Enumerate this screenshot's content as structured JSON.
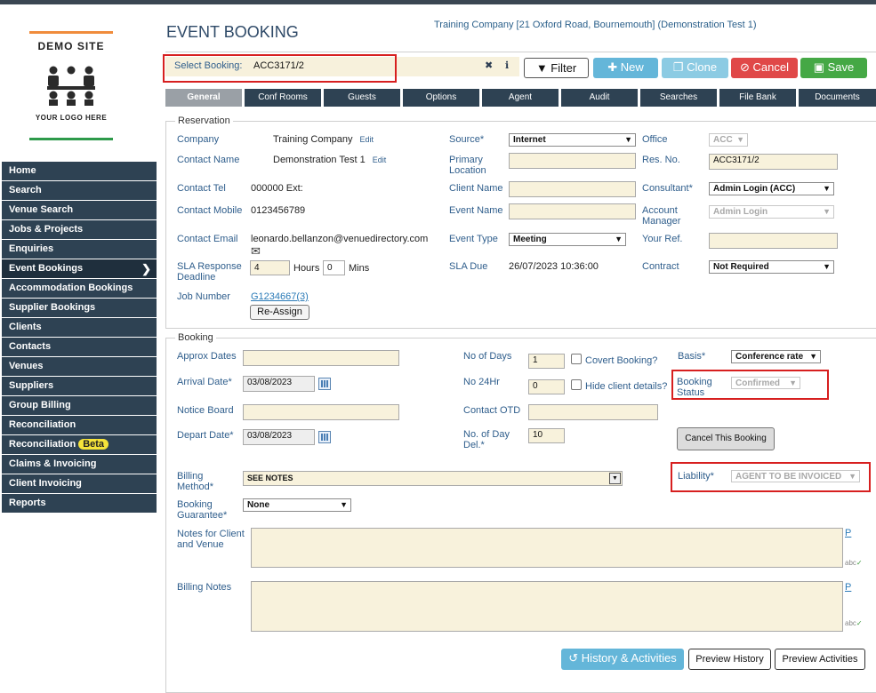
{
  "logo": {
    "line1": "DEMO SITE",
    "line2": "YOUR LOGO HERE",
    "accent_top": "#f08c3c",
    "accent_bottom": "#2e9a4a"
  },
  "nav": {
    "items": [
      {
        "label": "Home"
      },
      {
        "label": "Search"
      },
      {
        "label": "Venue Search"
      },
      {
        "label": "Jobs & Projects"
      },
      {
        "label": "Enquiries"
      },
      {
        "label": "Event Bookings",
        "active": true
      },
      {
        "label": "Accommodation Bookings"
      },
      {
        "label": "Supplier Bookings"
      },
      {
        "label": "Clients"
      },
      {
        "label": "Contacts"
      },
      {
        "label": "Venues"
      },
      {
        "label": "Suppliers"
      },
      {
        "label": "Group Billing"
      },
      {
        "label": "Reconciliation"
      },
      {
        "label": "Reconciliation",
        "badge": "Beta"
      },
      {
        "label": "Claims & Invoicing"
      },
      {
        "label": "Client Invoicing"
      },
      {
        "label": "Reports"
      }
    ]
  },
  "header": {
    "title": "EVENT BOOKING",
    "company": "Training Company [21 Oxford Road, Bournemouth] (Demonstration Test 1)"
  },
  "select_booking": {
    "label": "Select Booking:",
    "value": "ACC3171/2",
    "clear": "✖",
    "info": "ℹ"
  },
  "toolbar": {
    "filter": "Filter",
    "new": "New",
    "clone": "Clone",
    "cancel": "Cancel",
    "save": "Save"
  },
  "tabs": [
    "General",
    "Conf Rooms",
    "Guests",
    "Options",
    "Agent",
    "Audit",
    "Searches",
    "File Bank",
    "Documents"
  ],
  "reservation": {
    "legend": "Reservation",
    "company_label": "Company",
    "company_value": "Training Company",
    "edit": "Edit",
    "contact_name_label": "Contact Name",
    "contact_name_value": "Demonstration Test 1",
    "contact_tel_label": "Contact Tel",
    "contact_tel_value": "000000 Ext:",
    "contact_mobile_label": "Contact Mobile",
    "contact_mobile_value": "0123456789",
    "contact_email_label": "Contact Email",
    "contact_email_value": "leonardo.bellanzon@venuedirectory.com",
    "sla_label": "SLA Response Deadline",
    "sla_hours": "4",
    "hours": "Hours",
    "sla_mins": "0",
    "mins": "Mins",
    "job_number_label": "Job Number",
    "job_number_value": "G1234667(3)",
    "reassign": "Re-Assign",
    "source_label": "Source*",
    "source_value": "Internet",
    "primary_location_label": "Primary Location",
    "client_name_label": "Client Name",
    "event_name_label": "Event Name",
    "event_type_label": "Event Type",
    "event_type_value": "Meeting",
    "sla_due_label": "SLA Due",
    "sla_due_value": "26/07/2023 10:36:00",
    "office_label": "Office",
    "office_value": "ACC",
    "res_no_label": "Res. No.",
    "res_no_value": "ACC3171/2",
    "consultant_label": "Consultant*",
    "consultant_value": "Admin Login (ACC)",
    "account_manager_label": "Account Manager",
    "account_manager_value": "Admin Login",
    "your_ref_label": "Your Ref.",
    "contract_label": "Contract",
    "contract_value": "Not Required"
  },
  "booking": {
    "legend": "Booking",
    "approx_dates_label": "Approx Dates",
    "arrival_label": "Arrival Date*",
    "arrival_value": "03/08/2023",
    "notice_board_label": "Notice Board",
    "depart_label": "Depart Date*",
    "depart_value": "03/08/2023",
    "no_days_label": "No of Days",
    "no_days_value": "1",
    "covert_label": "Covert Booking?",
    "no24_label": "No 24Hr",
    "no24_value": "0",
    "hide_client_label": "Hide client details?",
    "contact_otd_label": "Contact OTD",
    "day_del_label": "No. of Day Del.*",
    "day_del_value": "10",
    "basis_label": "Basis*",
    "basis_value": "Conference rate",
    "status_label": "Booking Status",
    "status_value": "Confirmed",
    "cancel_booking": "Cancel This Booking",
    "billing_method_label": "Billing Method*",
    "billing_method_value": "SEE NOTES",
    "guarantee_label": "Booking Guarantee*",
    "guarantee_value": "None",
    "liability_label": "Liability*",
    "liability_value": "AGENT TO BE INVOICED",
    "notes_label": "Notes for Client and Venue",
    "billing_notes_label": "Billing Notes",
    "p": "P",
    "abc": "abc"
  },
  "footer": {
    "history": "History & Activities",
    "preview_history": "Preview History",
    "preview_activities": "Preview Activities"
  }
}
